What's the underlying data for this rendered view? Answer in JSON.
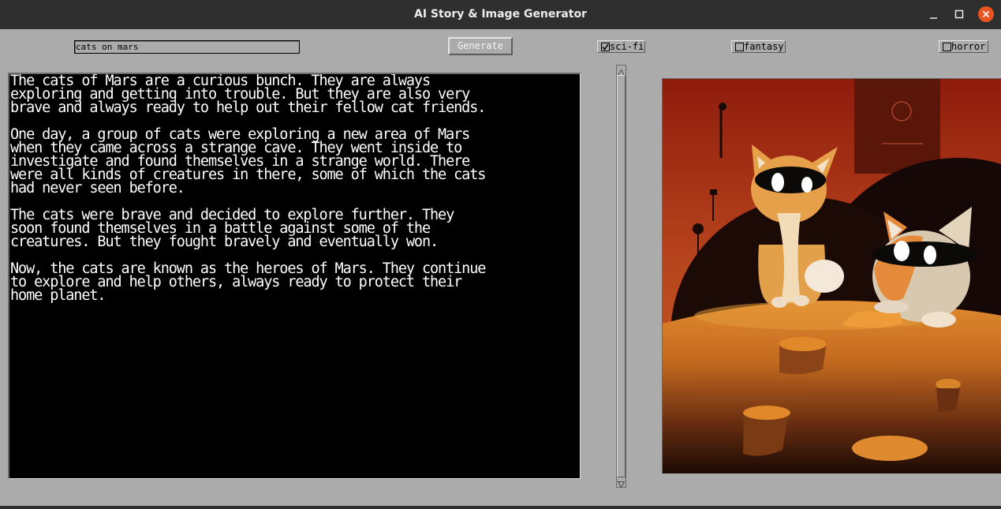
{
  "window": {
    "title": "AI Story & Image Generator"
  },
  "icons": {
    "minimize": "minimize-icon",
    "maximize": "maximize-icon",
    "close": "close-icon",
    "scroll_up": "arrow-up-icon",
    "scroll_down": "arrow-down-icon"
  },
  "toolbar": {
    "prompt_value": "cats on mars",
    "generate_label": "Generate",
    "genres": [
      {
        "label": "sci-fi",
        "checked": true
      },
      {
        "label": "fantasy",
        "checked": false
      },
      {
        "label": "horror",
        "checked": false
      }
    ]
  },
  "story": {
    "paragraphs": [
      "The cats of Mars are a curious bunch. They are always\nexploring and getting into trouble. But they are also very\nbrave and always ready to help out their fellow cat friends.",
      "One day, a group of cats were exploring a new area of Mars\nwhen they came across a strange cave. They went inside to\ninvestigate and found themselves in a strange world. There\nwere all kinds of creatures in there, some of which the cats\nhad never seen before.",
      "The cats were brave and decided to explore further. They\nsoon found themselves in a battle against some of the\ncreatures. But they fought bravely and eventually won.",
      "Now, the cats are known as the heroes of Mars. They continue\nto explore and help others, always ready to protect their\nhome planet."
    ]
  },
  "colors": {
    "window_bg": "#ababab",
    "titlebar_bg": "#2f2f2f",
    "close_button": "#e95420",
    "story_bg": "#000000",
    "story_text": "#ffffff"
  }
}
